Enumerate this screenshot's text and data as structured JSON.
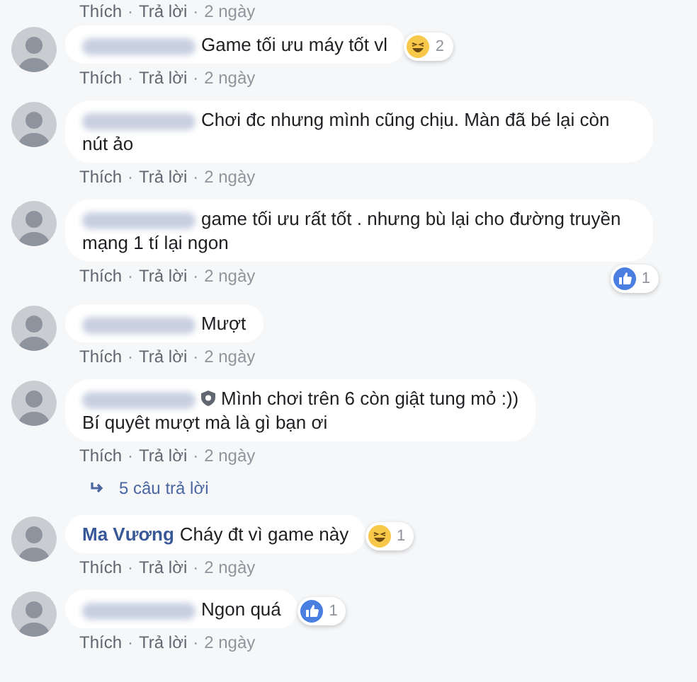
{
  "top_actions": {
    "like": "Thích",
    "dot": "·",
    "reply": "Trả lời",
    "time": "2 ngày"
  },
  "comments": [
    {
      "name_hidden": true,
      "text": "Game tối ưu máy tốt vl",
      "reaction": {
        "kind": "haha",
        "count": "2",
        "detached": false
      },
      "like": "Thích",
      "reply": "Trả lời",
      "time": "2 ngày"
    },
    {
      "name_hidden": true,
      "text": "Chơi đc nhưng mình cũng chịu. Màn đã bé lại còn nút ảo",
      "like": "Thích",
      "reply": "Trả lời",
      "time": "2 ngày"
    },
    {
      "name_hidden": true,
      "text": "game tối ưu rất tốt . nhưng bù lại cho đường truyền mạng 1 tí lại ngon",
      "reaction": {
        "kind": "like",
        "count": "1",
        "detached": true
      },
      "like": "Thích",
      "reply": "Trả lời",
      "time": "2 ngày"
    },
    {
      "name_hidden": true,
      "text": "Mượt",
      "like": "Thích",
      "reply": "Trả lời",
      "time": "2 ngày"
    },
    {
      "name_hidden": true,
      "badge": true,
      "text": "Mình chơi trên 6 còn giật tung mỏ :))\nBí quyêt mượt mà là gì bạn ơi",
      "like": "Thích",
      "reply": "Trả lời",
      "time": "2 ngày",
      "replies": "5 câu trả lời"
    },
    {
      "name_hidden": false,
      "author": "Ma Vương",
      "text": "Cháy đt vì game này",
      "reaction": {
        "kind": "haha",
        "count": "1",
        "detached": false
      },
      "like": "Thích",
      "reply": "Trả lời",
      "time": "2 ngày"
    },
    {
      "name_hidden": true,
      "text": "Ngon quá",
      "reaction": {
        "kind": "like",
        "count": "1",
        "detached": false
      },
      "like": "Thích",
      "reply": "Trả lời",
      "time": "2 ngày"
    }
  ]
}
